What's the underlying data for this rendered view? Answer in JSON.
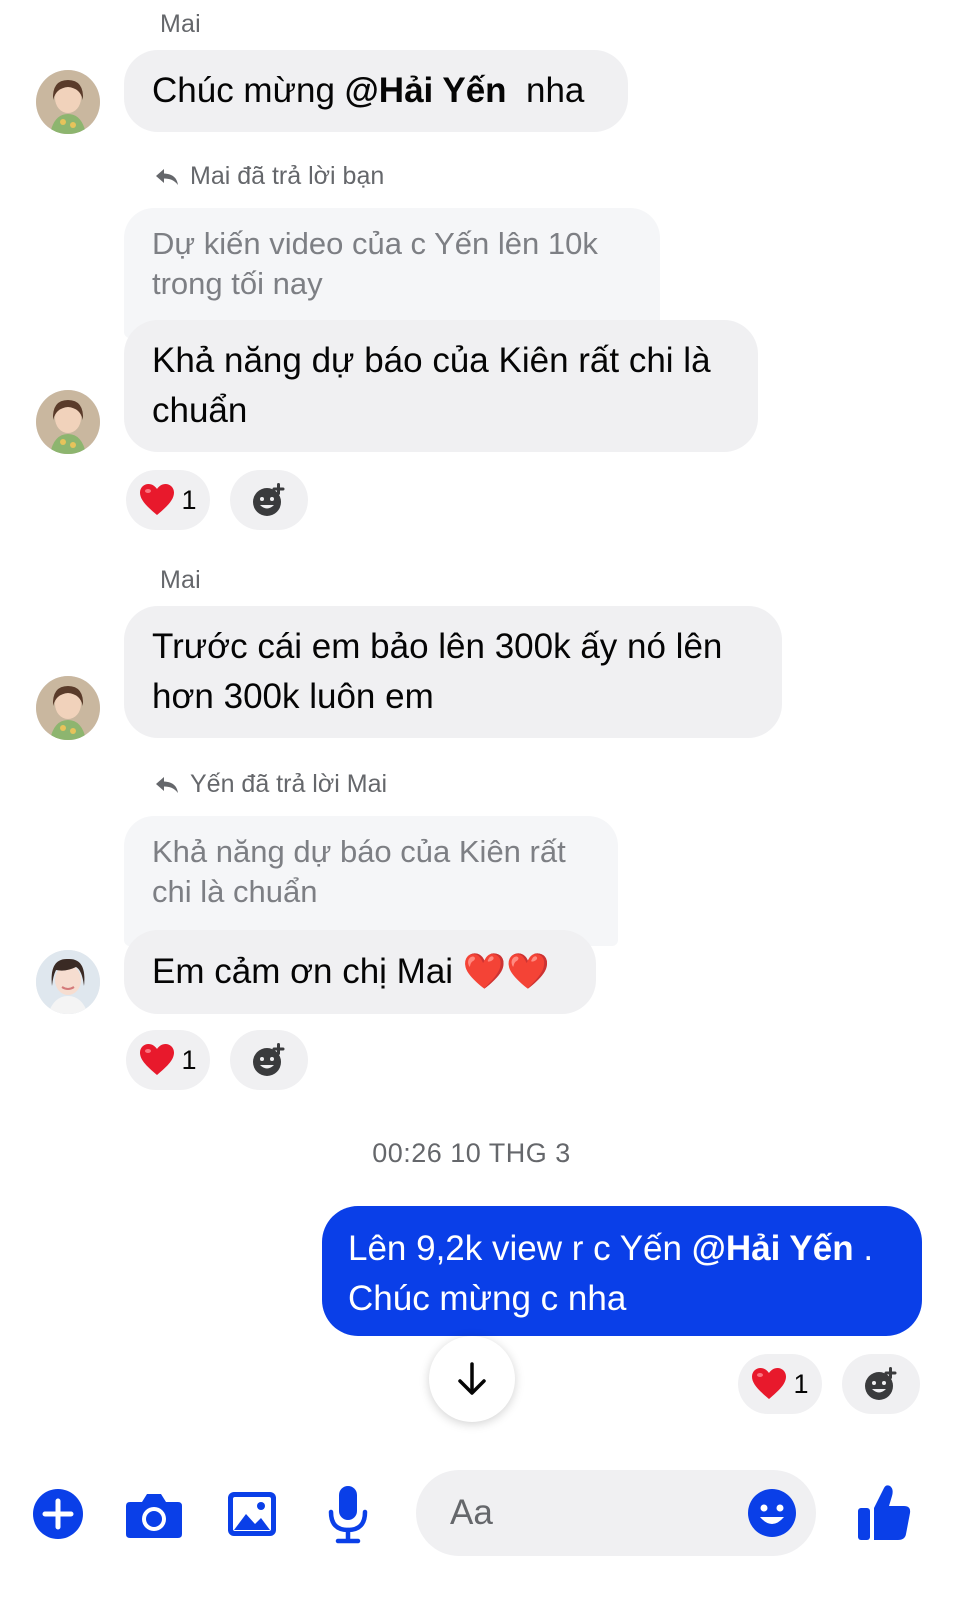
{
  "colors": {
    "accent": "#0a3fe8",
    "bubble_in": "#f0f0f2",
    "heart": "#e8192c"
  },
  "messages": {
    "m1": {
      "sender": "Mai",
      "prefix": "Chúc mừng ",
      "mention": "@Hải Yến",
      "suffix": "  nha",
      "avatar": "mai-avatar"
    },
    "m2": {
      "reply_hint": "Mai đã trả lời bạn",
      "quoted": "Dự kiến video của c Yến lên 10k trong tối nay",
      "text": "Khả năng dự báo của Kiên rất chi là chuẩn",
      "reaction_icon": "heart-icon",
      "reaction_count": "1"
    },
    "m3": {
      "sender": "Mai",
      "text": "Trước cái em bảo lên 300k ấy nó lên hơn 300k luôn em"
    },
    "m4": {
      "reply_hint": "Yến đã trả lời Mai",
      "quoted": "Khả năng dự báo của Kiên rất chi là chuẩn",
      "text": "Em cảm ơn chị Mai ",
      "hearts": "❤️❤️",
      "reaction_icon": "heart-icon",
      "reaction_count": "1",
      "avatar": "yen-avatar"
    },
    "timestamp": "00:26 10 THG 3",
    "m5": {
      "prefix": "Lên 9,2k view r c Yến ",
      "mention": "@Hải Yến",
      "suffix": " . Chúc mừng c nha",
      "reaction_icon": "heart-icon",
      "reaction_count": "1"
    }
  },
  "composer": {
    "placeholder": "Aa",
    "icons": [
      "plus-icon",
      "camera-icon",
      "image-icon",
      "microphone-icon",
      "emoji-icon",
      "thumbs-up-icon"
    ]
  },
  "scroll_button_icon": "arrow-down-icon"
}
